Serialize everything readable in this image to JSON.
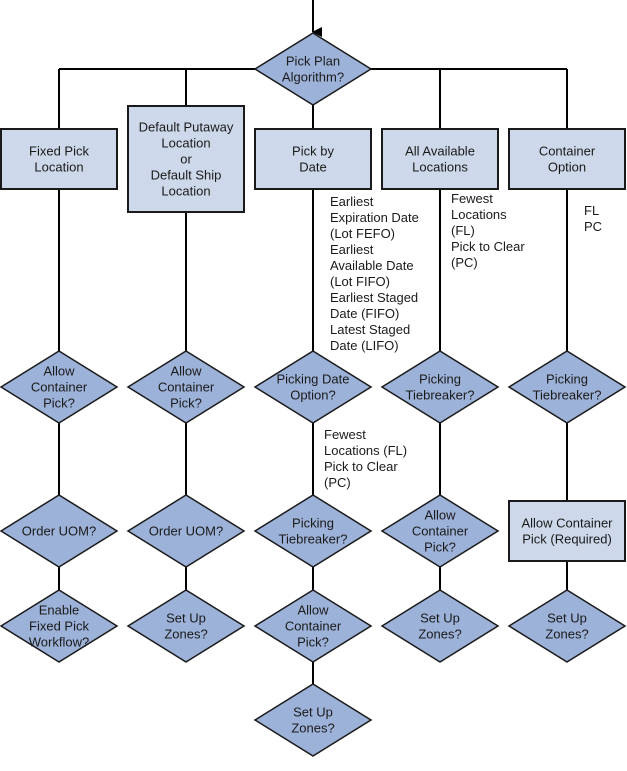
{
  "diagram": {
    "start_node": {
      "id": "pick-plan-algorithm",
      "lines": [
        "Pick Plan",
        "Algorithm?"
      ],
      "shape": "diamond"
    },
    "branches": [
      {
        "id": "fixed-pick-location",
        "box": [
          "Fixed Pick",
          "Location"
        ],
        "note": [],
        "steps": [
          {
            "lines": [
              "Allow",
              "Container",
              "Pick?"
            ],
            "shape": "diamond",
            "note": []
          },
          {
            "lines": [
              "Order UOM?"
            ],
            "shape": "diamond",
            "note": []
          },
          {
            "lines": [
              "Enable",
              "Fixed Pick",
              "Workflow?"
            ],
            "shape": "diamond",
            "note": []
          }
        ]
      },
      {
        "id": "default-putaway-location",
        "box": [
          "Default Putaway",
          "Location",
          "or",
          "Default Ship",
          "Location"
        ],
        "note": [],
        "steps": [
          {
            "lines": [
              "Allow",
              "Container",
              "Pick?"
            ],
            "shape": "diamond",
            "note": []
          },
          {
            "lines": [
              "Order UOM?"
            ],
            "shape": "diamond",
            "note": []
          },
          {
            "lines": [
              "Set Up",
              "Zones?"
            ],
            "shape": "diamond",
            "note": []
          }
        ]
      },
      {
        "id": "pick-by-date",
        "box": [
          "Pick by",
          "Date"
        ],
        "note": [
          "Earliest",
          "Expiration Date",
          "(Lot FEFO)",
          "Earliest",
          "Available Date",
          "(Lot FIFO)",
          "Earliest Staged",
          "Date (FIFO)",
          "Latest Staged",
          "Date (LIFO)"
        ],
        "steps": [
          {
            "lines": [
              "Picking Date",
              "Option?"
            ],
            "shape": "diamond",
            "note": [
              "Fewest",
              "Locations (FL)",
              "Pick to Clear",
              "(PC)"
            ]
          },
          {
            "lines": [
              "Picking",
              "Tiebreaker?"
            ],
            "shape": "diamond",
            "note": []
          },
          {
            "lines": [
              "Allow",
              "Container",
              "Pick?"
            ],
            "shape": "diamond",
            "note": []
          },
          {
            "lines": [
              "Set Up",
              "Zones?"
            ],
            "shape": "diamond",
            "note": []
          }
        ]
      },
      {
        "id": "all-available-locations",
        "box": [
          "All Available",
          "Locations"
        ],
        "note": [
          "Fewest",
          "Locations",
          "(FL)",
          "Pick to Clear",
          "(PC)"
        ],
        "steps": [
          {
            "lines": [
              "Picking",
              "Tiebreaker?"
            ],
            "shape": "diamond",
            "note": []
          },
          {
            "lines": [
              "Allow",
              "Container",
              "Pick?"
            ],
            "shape": "diamond",
            "note": []
          },
          {
            "lines": [
              "Set Up",
              "Zones?"
            ],
            "shape": "diamond",
            "note": []
          }
        ]
      },
      {
        "id": "container-option",
        "box": [
          "Container",
          "Option"
        ],
        "note": [
          "FL",
          "PC"
        ],
        "steps": [
          {
            "lines": [
              "Picking",
              "Tiebreaker?"
            ],
            "shape": "diamond",
            "note": []
          },
          {
            "lines": [
              "Allow Container",
              "Pick (Required)"
            ],
            "shape": "box",
            "note": []
          },
          {
            "lines": [
              "Set Up",
              "Zones?"
            ],
            "shape": "diamond",
            "note": []
          }
        ]
      }
    ],
    "colors": {
      "box_fill": "#cdd9ea",
      "diamond_fill": "#9db2d9",
      "stroke": "#1a1a1a"
    }
  }
}
